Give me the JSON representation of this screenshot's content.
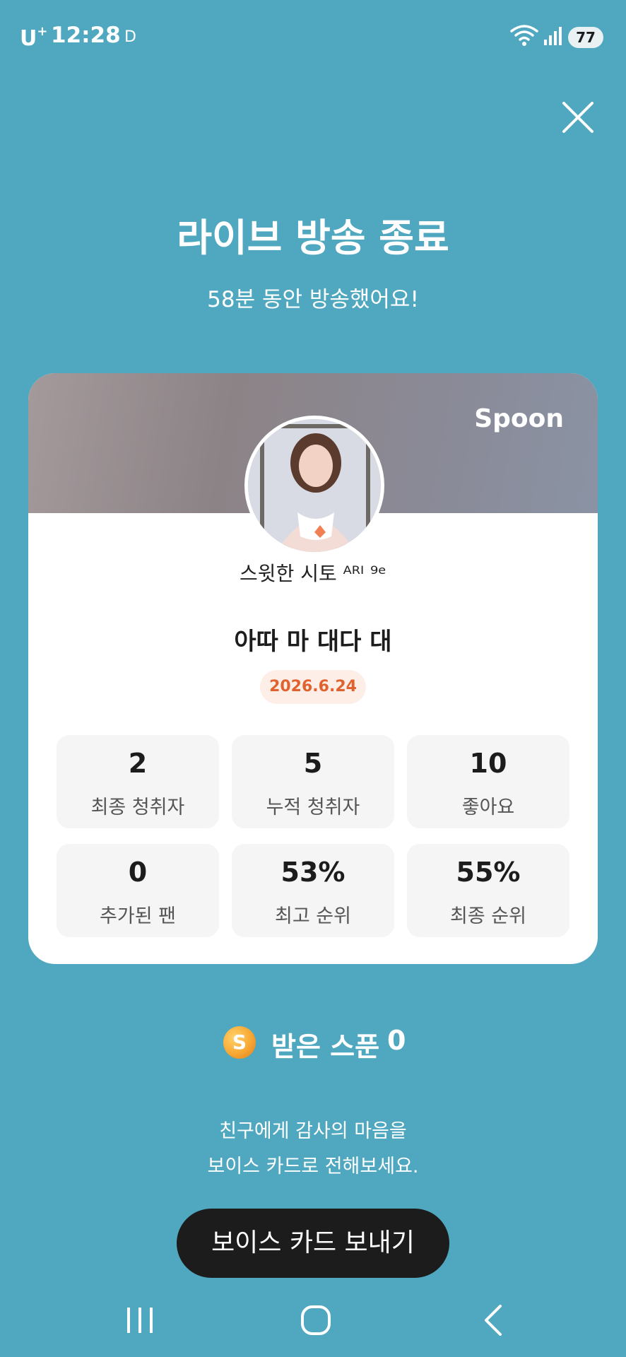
{
  "status_bar": {
    "carrier": "U",
    "carrier_super": "+",
    "time": "12:28",
    "indicator": "D",
    "battery": "77",
    "icons": [
      "wifi-icon",
      "signal-icon",
      "battery-icon"
    ]
  },
  "header": {
    "close_icon": "close-icon",
    "title": "라이브 방송 종료",
    "subtitle": "58분 동안 방송했어요!"
  },
  "card": {
    "brand": "Spoon",
    "host_name": "스윗한 시토 ᴬᴿᴵ ⁹ᵉ",
    "live_title": "아따 마 대다 대",
    "date": "2026.6.24",
    "stats": [
      {
        "value": "2",
        "label": "최종 청취자"
      },
      {
        "value": "5",
        "label": "누적 청취자"
      },
      {
        "value": "10",
        "label": "좋아요"
      },
      {
        "value": "0",
        "label": "추가된 팬"
      },
      {
        "value": "53%",
        "label": "최고 순위"
      },
      {
        "value": "55%",
        "label": "최종 순위"
      }
    ]
  },
  "spoons": {
    "coin": "S",
    "label": "받은 스푼",
    "count": "0"
  },
  "message": {
    "line1": "친구에게 감사의 마음을",
    "line2": "보이스 카드로 전해보세요."
  },
  "action": {
    "voice_card_button": "보이스 카드 보내기"
  },
  "nav": {
    "icons": [
      "recents-icon",
      "home-icon",
      "back-icon"
    ]
  },
  "colors": {
    "background": "#4fa8bf",
    "accent": "#e0622f",
    "button": "#1c1c1c"
  }
}
